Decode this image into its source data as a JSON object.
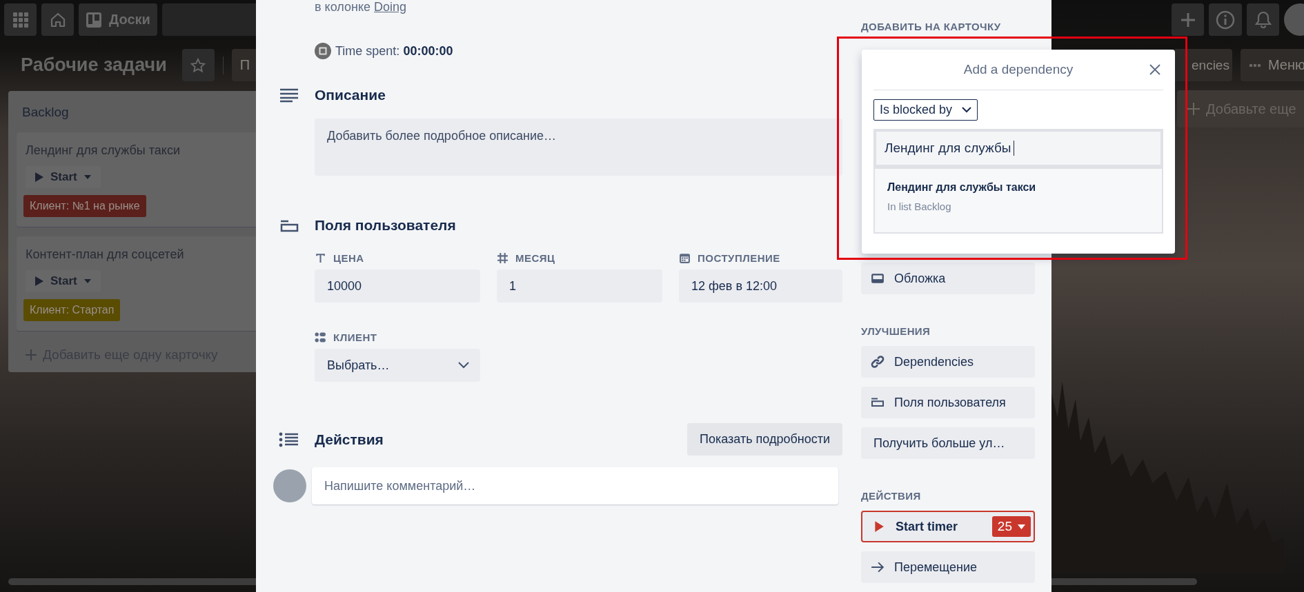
{
  "header": {
    "boards_button": "Доски"
  },
  "board": {
    "title": "Рабочие задачи",
    "partial_button": "П",
    "dependencies_button": "encies",
    "menu_button": "Меню",
    "add_list": "Добавьте еще"
  },
  "lists": [
    {
      "title": "Backlog",
      "add_card": "Добавить еще одну карточку",
      "cards": [
        {
          "title": "Лендинг для службы такси",
          "timer": "Start",
          "labels": [
            {
              "text": "Клиент: №1 на рынке",
              "color": "#5b201b"
            }
          ]
        },
        {
          "title": "Контент-план для соцсетей",
          "timer": "Start",
          "labels": [
            {
              "text": "Клиент: Стартап",
              "color": "#5a4c00"
            }
          ]
        }
      ]
    }
  ],
  "card_detail": {
    "list_prefix": "в колонке",
    "list_link": "Doing",
    "time_label": "Time spent:",
    "time_value": "00:00:00",
    "description": {
      "title": "Описание",
      "placeholder": "Добавить более подробное описание…"
    },
    "custom_fields": {
      "title": "Поля пользователя",
      "fields": [
        {
          "kind": "text",
          "label": "ЦЕНА",
          "value": "10000"
        },
        {
          "kind": "number",
          "label": "МЕСЯЦ",
          "value": "1"
        },
        {
          "kind": "date",
          "label": "ПОСТУПЛЕНИЕ",
          "value": "12 фев в 12:00"
        },
        {
          "kind": "list",
          "label": "КЛИЕНТ",
          "value": "Выбрать…"
        }
      ]
    },
    "activity": {
      "title": "Действия",
      "details_button": "Показать подробности",
      "comment_placeholder": "Напишите комментарий…"
    }
  },
  "sidebar": {
    "sections": [
      {
        "title": "ДОБАВИТЬ НА КАРТОЧКУ",
        "buttons": [
          {
            "kind": "cover",
            "label": "Обложка"
          }
        ]
      },
      {
        "title": "УЛУЧШЕНИЯ",
        "buttons": [
          {
            "kind": "link",
            "label": "Dependencies"
          },
          {
            "kind": "fields",
            "label": "Поля пользователя"
          },
          {
            "kind": "plain",
            "label": "Получить больше ул…"
          }
        ]
      },
      {
        "title": "ДЕЙСТВИЯ",
        "buttons": [
          {
            "kind": "timer",
            "label": "Start timer",
            "count": "25"
          },
          {
            "kind": "move",
            "label": "Перемещение"
          }
        ]
      }
    ]
  },
  "popup": {
    "title": "Add a dependency",
    "relation": "Is blocked by",
    "query": "Лендинг для службы",
    "results": [
      {
        "title": "Лендинг для службы такси",
        "subtitle": "In list Backlog"
      }
    ]
  }
}
